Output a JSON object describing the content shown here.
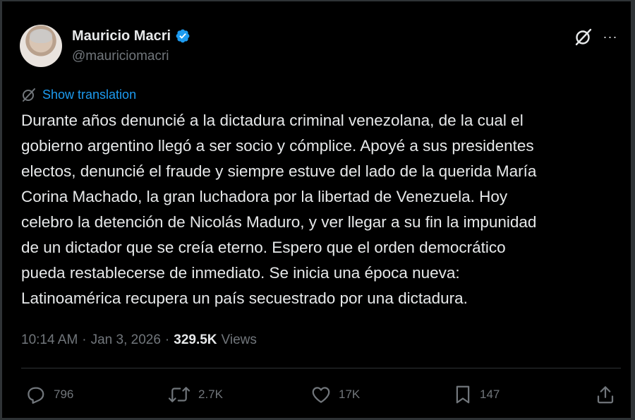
{
  "author": {
    "display_name": "Mauricio Macri",
    "handle": "@mauriciomacri",
    "verified": true,
    "verified_color": "#1d9bf0"
  },
  "header_icons": {
    "grok": "grok-slash-icon",
    "more": "more-horizontal-icon",
    "more_glyph": "···"
  },
  "translation": {
    "icon": "globe-slash-icon",
    "label": "Show translation"
  },
  "tweet": {
    "lines": [
      "Durante años denuncié a la dictadura criminal venezolana, de la cual el",
      "gobierno argentino llegó a ser socio y cómplice. Apoyé a sus presidentes",
      "electos, denuncié el fraude y siempre estuve del lado de la querida María",
      "Corina Machado, la gran luchadora por la libertad de Venezuela. Hoy",
      "celebro la detención de Nicolás Maduro, y ver llegar a su fin la impunidad",
      "de un dictador que se creía eterno. Espero que el orden democrático",
      "pueda restablecerse de inmediato. Se inicia una época nueva:",
      "Latinoamérica recupera un país secuestrado por una dictadura."
    ]
  },
  "meta": {
    "time": "10:14 AM",
    "separator": "·",
    "date": "Jan 3, 2026",
    "views_count": "329.5K",
    "views_label": "Views"
  },
  "actions": {
    "reply": {
      "icon": "reply-icon",
      "count": "796"
    },
    "repost": {
      "icon": "repost-icon",
      "count": "2.7K"
    },
    "like": {
      "icon": "heart-icon",
      "count": "17K"
    },
    "bookmark": {
      "icon": "bookmark-icon",
      "count": "147"
    },
    "share": {
      "icon": "share-icon"
    }
  },
  "colors": {
    "background": "#000000",
    "text": "#e7e9ea",
    "muted": "#71767b",
    "accent": "#1d9bf0",
    "border": "#2f3336"
  }
}
